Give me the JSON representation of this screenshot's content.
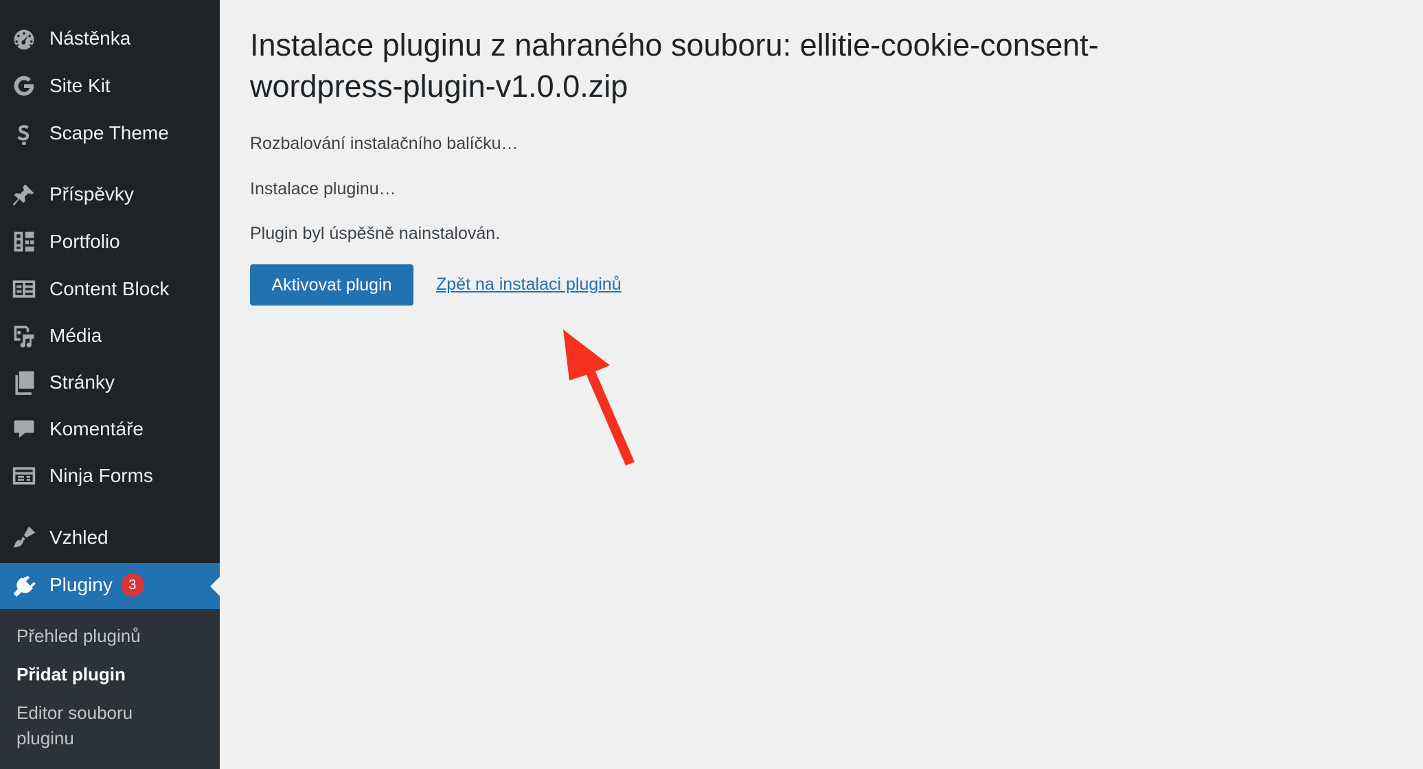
{
  "sidebar": {
    "items": [
      {
        "label": "Nástěnka",
        "icon": "dashboard-icon"
      },
      {
        "label": "Site Kit",
        "icon": "google-g-icon"
      },
      {
        "label": "Scape Theme",
        "icon": "scape-s-icon"
      },
      {
        "label": "Příspěvky",
        "icon": "pushpin-icon"
      },
      {
        "label": "Portfolio",
        "icon": "portfolio-icon"
      },
      {
        "label": "Content Block",
        "icon": "content-block-icon"
      },
      {
        "label": "Média",
        "icon": "media-icon"
      },
      {
        "label": "Stránky",
        "icon": "pages-icon"
      },
      {
        "label": "Komentáře",
        "icon": "comment-icon"
      },
      {
        "label": "Ninja Forms",
        "icon": "forms-icon"
      },
      {
        "label": "Vzhled",
        "icon": "paintbrush-icon"
      },
      {
        "label": "Pluginy",
        "icon": "plugin-icon",
        "badge": "3",
        "active": true
      }
    ],
    "submenu": [
      {
        "label": "Přehled pluginů"
      },
      {
        "label": "Přidat plugin",
        "current": true
      },
      {
        "label": "Editor souboru pluginu"
      }
    ]
  },
  "main": {
    "title": "Instalace pluginu z nahraného souboru: ellitie-cookie-consent-wordpress-plugin-v1.0.0.zip",
    "messages": [
      "Rozbalování instalačního balíčku…",
      "Instalace pluginu…",
      "Plugin byl úspěšně nainstalován."
    ],
    "activate_label": "Aktivovat plugin",
    "back_link_label": "Zpět na instalaci pluginů"
  },
  "colors": {
    "sidebar_bg": "#1d2327",
    "submenu_bg": "#2c3338",
    "accent": "#2271b1",
    "badge": "#d63638",
    "annotation_arrow": "#f5311e",
    "page_bg": "#f0f0f1"
  }
}
